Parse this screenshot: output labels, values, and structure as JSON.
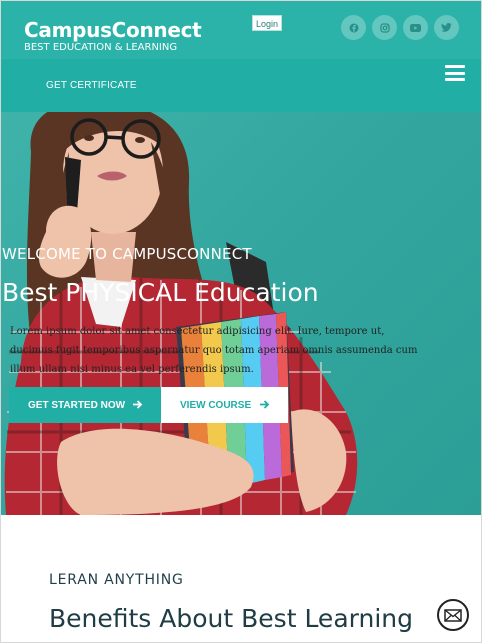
{
  "header": {
    "brand_name": "CampusConnect",
    "brand_tagline": "BEST EDUCATION & LEARNING",
    "login_label": "Login",
    "social_icons": [
      "facebook-icon",
      "instagram-icon",
      "youtube-icon",
      "twitter-icon"
    ]
  },
  "nav": {
    "get_certificate_label": "GET CERTIFICATE",
    "menu_icon": "hamburger-icon"
  },
  "hero": {
    "kicker": "WELCOME TO CAMPUSCONNECT",
    "title": "Best PHYSICAL Education",
    "text": "Lorem ipsum dolor sit amet consectetur adipisicing elit. Iure, tempore ut, ducimus fugit temporibus aspernatur quo totam aperiam omnis assumenda cum illum ullam nisi minus ea vel perferendis ipsum.",
    "primary_button": "GET STARTED NOW",
    "secondary_button": "VIEW COURSE"
  },
  "benefits": {
    "kicker": "LERAN ANYTHING",
    "title": "Benefits About Best Learning"
  },
  "floating": {
    "mail_icon": "mail-icon"
  },
  "colors": {
    "brand_teal": "#2bb3a9",
    "nav_teal": "#20aea5",
    "heading_dark": "#203c44"
  }
}
